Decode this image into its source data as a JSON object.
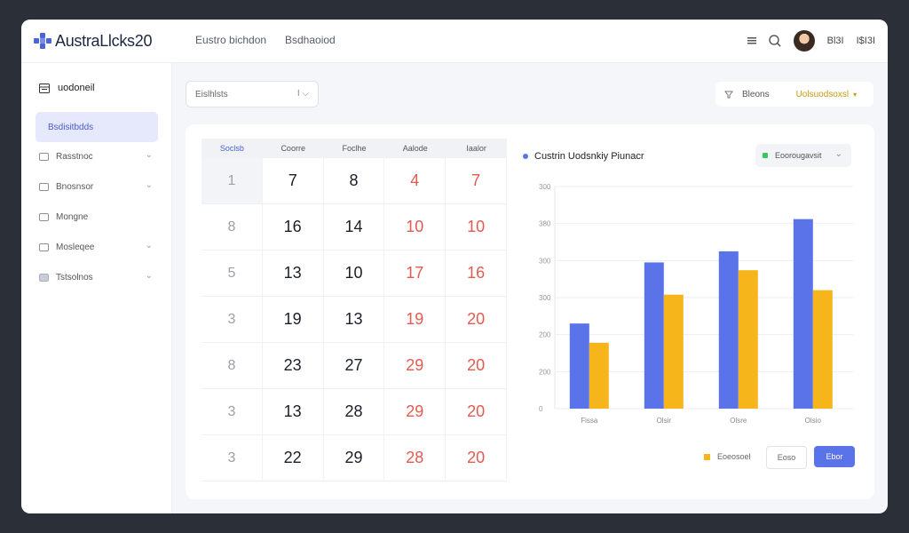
{
  "app": {
    "title": "AustraLlcks20"
  },
  "topnav": [
    "Eustro bichdon",
    "Bsdhaoiod"
  ],
  "topbar_right": {
    "user_text": "Bl3I",
    "menu_text": "I$I3I"
  },
  "sidebar": {
    "header": "uodoneil",
    "items": [
      {
        "label": "Bsdisitbdds",
        "active": true,
        "chevron": false
      },
      {
        "label": "Rasstnoc",
        "active": false,
        "chevron": true
      },
      {
        "label": "Bnosnsor",
        "active": false,
        "chevron": true
      },
      {
        "label": "Mongne",
        "active": false,
        "chevron": false
      },
      {
        "label": "Mosleqee",
        "active": false,
        "chevron": true
      },
      {
        "label": "Tstsolnos",
        "active": false,
        "chevron": true
      }
    ]
  },
  "filter": {
    "value": "Eislhlsts",
    "caret": "I ⌵"
  },
  "toolbar_pill": {
    "left": "Bleons",
    "right": "Uolsuodsoxsl"
  },
  "calendar": {
    "headers": [
      "Soclsb",
      "Coorre",
      "Foclhe",
      "Aalode",
      "Iaalor"
    ],
    "rows": [
      [
        {
          "v": "1",
          "c": "muted"
        },
        {
          "v": "7",
          "c": ""
        },
        {
          "v": "8",
          "c": ""
        },
        {
          "v": "4",
          "c": "red"
        },
        {
          "v": "7",
          "c": "red"
        }
      ],
      [
        {
          "v": "8",
          "c": "muted"
        },
        {
          "v": "16",
          "c": ""
        },
        {
          "v": "14",
          "c": ""
        },
        {
          "v": "10",
          "c": "red"
        },
        {
          "v": "10",
          "c": "red"
        }
      ],
      [
        {
          "v": "5",
          "c": "muted"
        },
        {
          "v": "13",
          "c": ""
        },
        {
          "v": "10",
          "c": ""
        },
        {
          "v": "17",
          "c": "red"
        },
        {
          "v": "16",
          "c": "red"
        }
      ],
      [
        {
          "v": "3",
          "c": "muted"
        },
        {
          "v": "19",
          "c": ""
        },
        {
          "v": "13",
          "c": ""
        },
        {
          "v": "19",
          "c": "red"
        },
        {
          "v": "20",
          "c": "red"
        }
      ],
      [
        {
          "v": "8",
          "c": "muted"
        },
        {
          "v": "23",
          "c": ""
        },
        {
          "v": "27",
          "c": ""
        },
        {
          "v": "29",
          "c": "red"
        },
        {
          "v": "20",
          "c": "red"
        }
      ],
      [
        {
          "v": "3",
          "c": "muted"
        },
        {
          "v": "13",
          "c": ""
        },
        {
          "v": "28",
          "c": ""
        },
        {
          "v": "29",
          "c": "red"
        },
        {
          "v": "20",
          "c": "red"
        }
      ],
      [
        {
          "v": "3",
          "c": "muted"
        },
        {
          "v": "22",
          "c": ""
        },
        {
          "v": "29",
          "c": ""
        },
        {
          "v": "28",
          "c": "red"
        },
        {
          "v": "20",
          "c": "red"
        }
      ]
    ]
  },
  "chart_data": {
    "type": "bar",
    "title": "Custrin Uodsnkiy Piunacr",
    "categories": [
      "Fissa",
      "Olsir",
      "Olsre",
      "Olsio"
    ],
    "series": [
      {
        "values": [
          230,
          395,
          425,
          512
        ],
        "color": "#5b73e8"
      },
      {
        "values": [
          178,
          308,
          374,
          320
        ],
        "color": "#f5b51b"
      }
    ],
    "y_ticks": [
      "0",
      "200",
      "200",
      "300",
      "300",
      "380",
      "300"
    ],
    "ylim": [
      0,
      600
    ],
    "grid": true
  },
  "chart_select": {
    "label": "Eoorougavsit"
  },
  "footer": {
    "legend_label": "Eoeosoel",
    "ghost_btn": "Eoso",
    "primary_btn": "Ebor"
  },
  "colors": {
    "accent": "#5b73e8",
    "secondary": "#f5b51b",
    "danger": "#e35a50"
  }
}
